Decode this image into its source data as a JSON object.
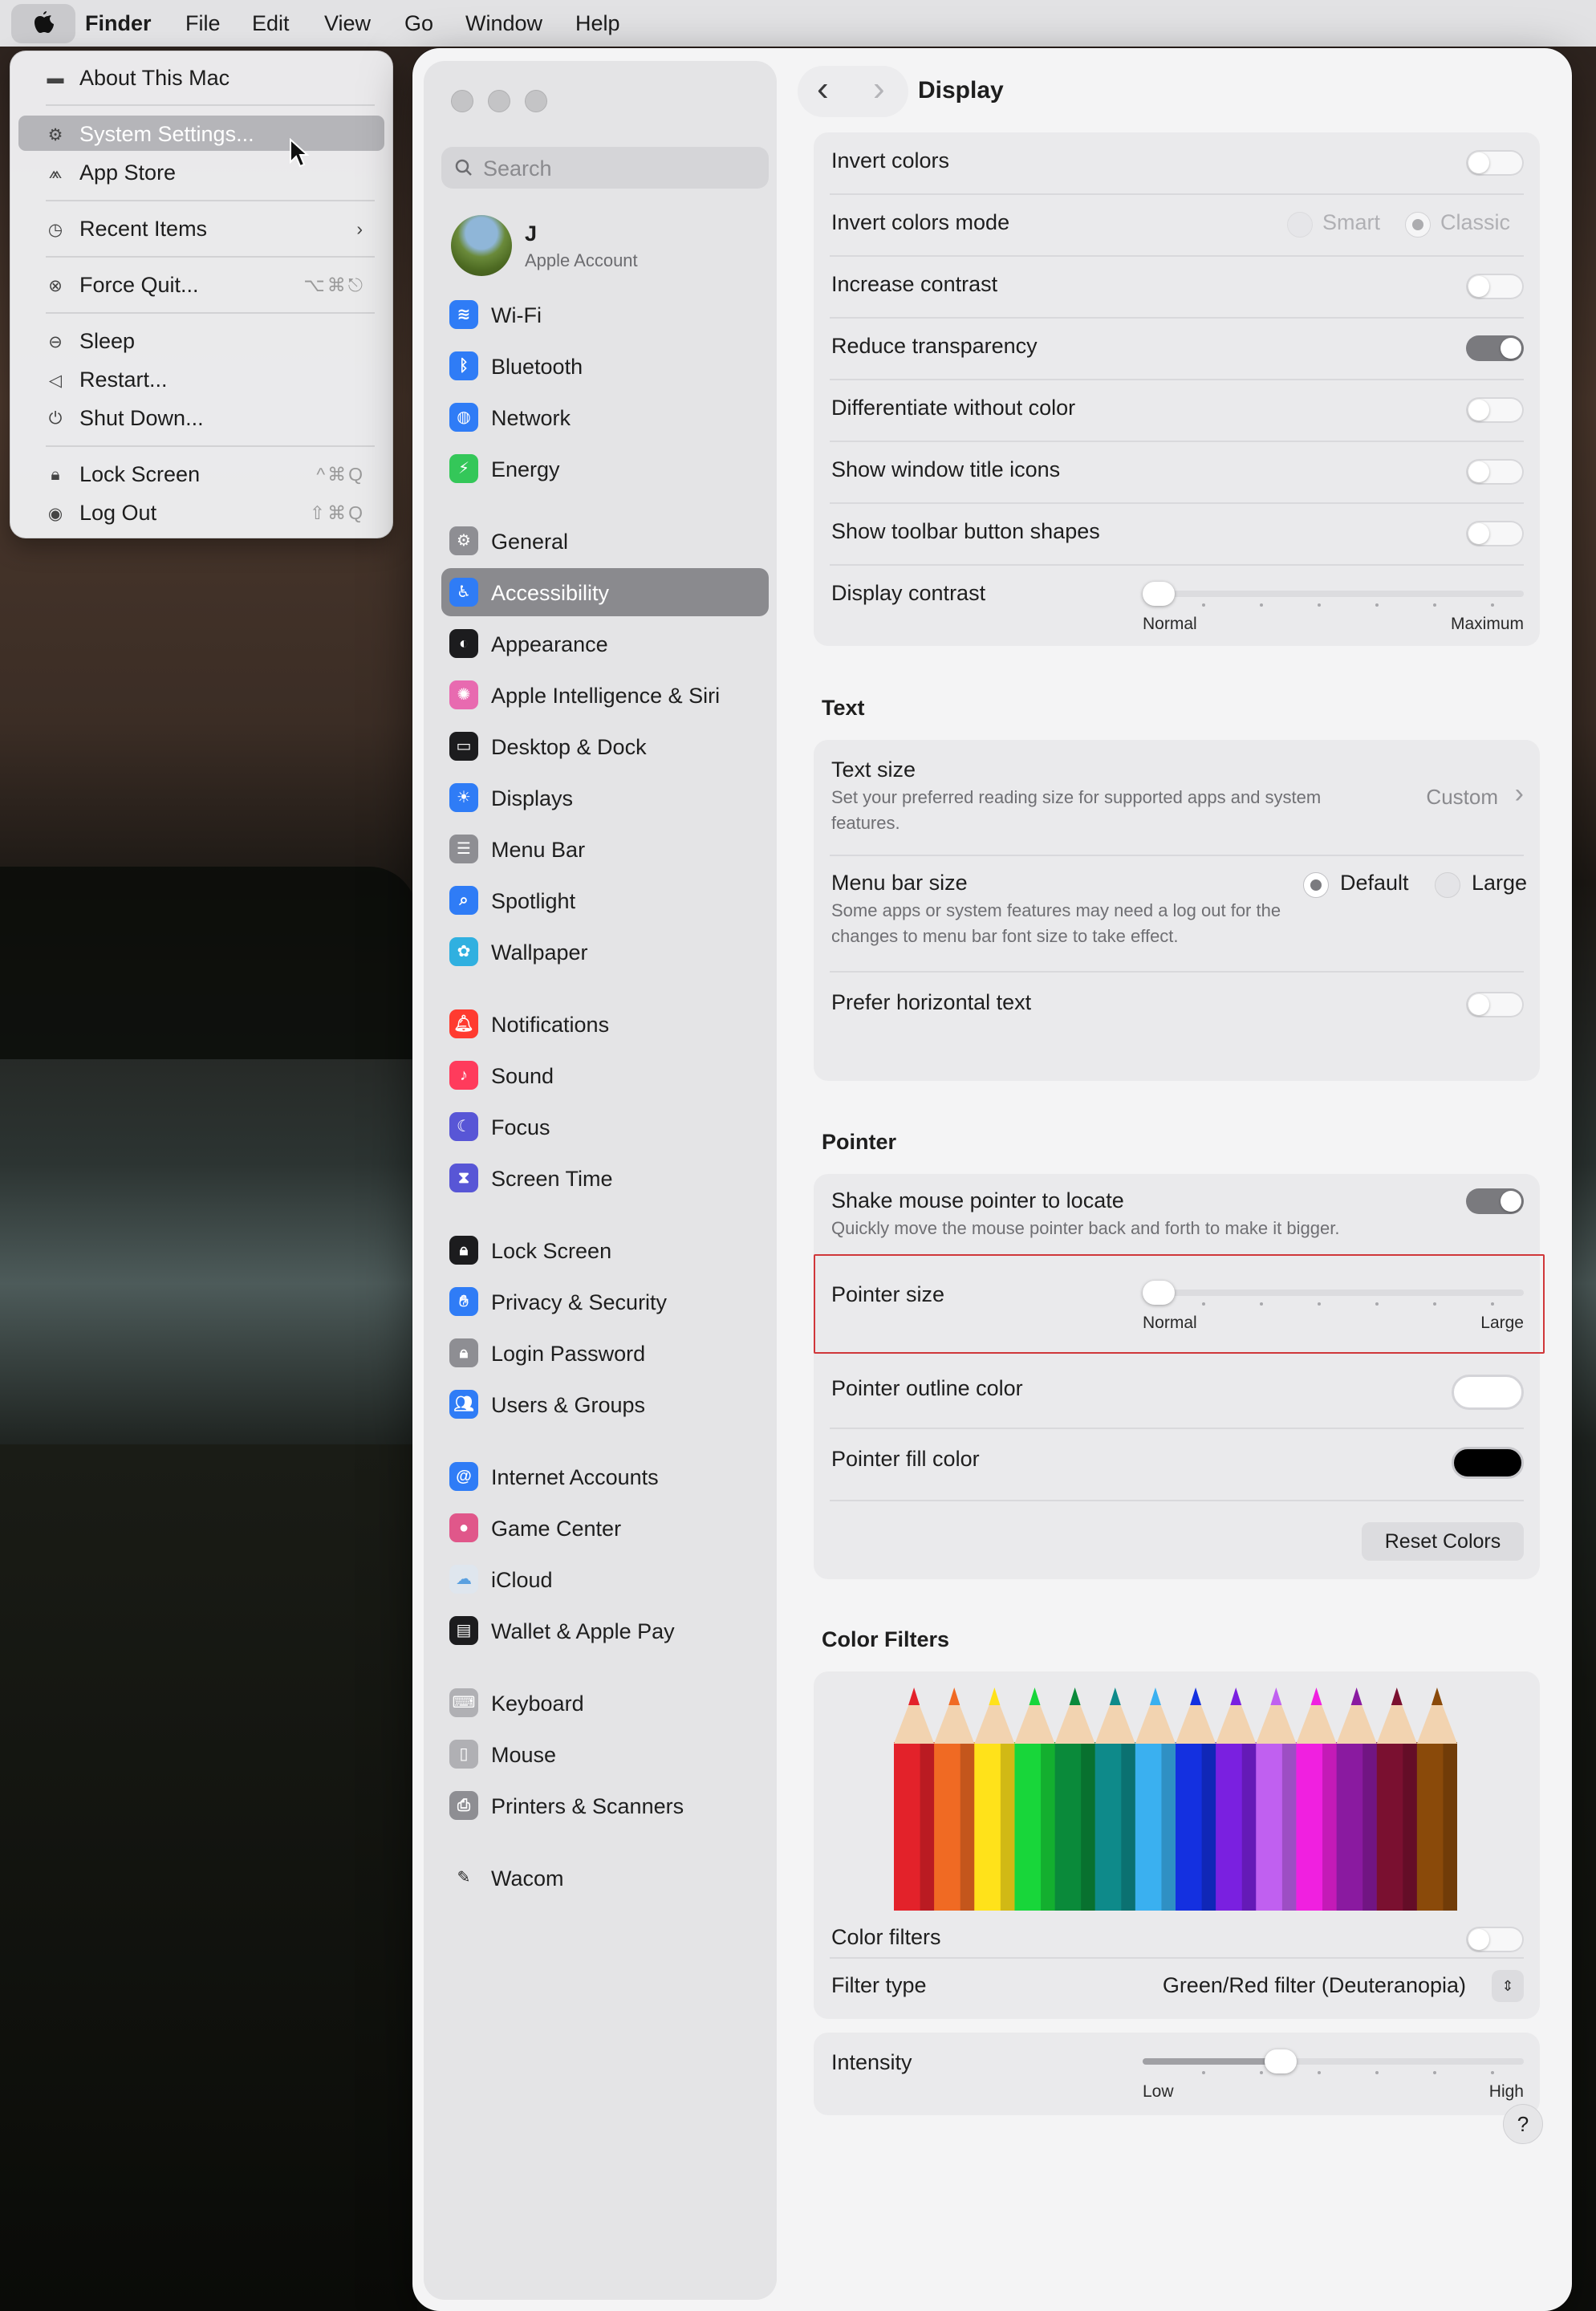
{
  "menubar": {
    "app_name": "Finder",
    "menus": [
      "File",
      "Edit",
      "View",
      "Go",
      "Window",
      "Help"
    ]
  },
  "apple_menu": {
    "items": [
      {
        "label": "About This Mac",
        "icon": "laptop-icon",
        "shortcut": ""
      },
      {
        "label": "System Settings...",
        "icon": "gear-icon",
        "shortcut": ""
      },
      {
        "label": "App Store",
        "icon": "app-store-icon",
        "shortcut": ""
      },
      {
        "label": "Recent Items",
        "icon": "clock-icon",
        "shortcut": ""
      },
      {
        "label": "Force Quit...",
        "icon": "force-quit-icon",
        "shortcut": "⌥⌘⎋"
      },
      {
        "label": "Sleep",
        "icon": "moon-icon",
        "shortcut": ""
      },
      {
        "label": "Restart...",
        "icon": "restart-icon",
        "shortcut": ""
      },
      {
        "label": "Shut Down...",
        "icon": "power-icon",
        "shortcut": ""
      },
      {
        "label": "Lock Screen",
        "icon": "lock-icon",
        "shortcut": "^⌘Q"
      },
      {
        "label": "Log Out",
        "icon": "user-icon",
        "shortcut": "⇧⌘Q"
      }
    ]
  },
  "sidebar": {
    "search_placeholder": "Search",
    "account": {
      "name": "J",
      "subtitle": "Apple Account"
    },
    "items": [
      {
        "label": "Wi-Fi",
        "icon": "wifi-icon",
        "color": "#2f7cf6"
      },
      {
        "label": "Bluetooth",
        "icon": "bluetooth-icon",
        "color": "#2f7cf6"
      },
      {
        "label": "Network",
        "icon": "globe-icon",
        "color": "#2f7cf6"
      },
      {
        "label": "Energy",
        "icon": "battery-icon",
        "color": "#34c759"
      },
      {
        "label": "General",
        "icon": "gear-icon",
        "color": "#8e8e93"
      },
      {
        "label": "Accessibility",
        "icon": "accessibility-icon",
        "color": "#2f7cf6"
      },
      {
        "label": "Appearance",
        "icon": "appearance-icon",
        "color": "#1c1c1e"
      },
      {
        "label": "Apple Intelligence & Siri",
        "icon": "siri-icon",
        "color": "#e86ab0"
      },
      {
        "label": "Desktop & Dock",
        "icon": "dock-icon",
        "color": "#1c1c1e"
      },
      {
        "label": "Displays",
        "icon": "sun-icon",
        "color": "#2f7cf6"
      },
      {
        "label": "Menu Bar",
        "icon": "menubar-icon",
        "color": "#8e8e93"
      },
      {
        "label": "Spotlight",
        "icon": "magnifier-icon",
        "color": "#2f7cf6"
      },
      {
        "label": "Wallpaper",
        "icon": "flower-icon",
        "color": "#30b0e0"
      },
      {
        "label": "Notifications",
        "icon": "bell-icon",
        "color": "#ff3b30"
      },
      {
        "label": "Sound",
        "icon": "speaker-icon",
        "color": "#ff3b5c"
      },
      {
        "label": "Focus",
        "icon": "moon-icon",
        "color": "#5856d6"
      },
      {
        "label": "Screen Time",
        "icon": "hourglass-icon",
        "color": "#5856d6"
      },
      {
        "label": "Lock Screen",
        "icon": "lock-icon",
        "color": "#1c1c1e"
      },
      {
        "label": "Privacy & Security",
        "icon": "hand-icon",
        "color": "#2f7cf6"
      },
      {
        "label": "Login Password",
        "icon": "lock-icon",
        "color": "#8e8e93"
      },
      {
        "label": "Users & Groups",
        "icon": "users-icon",
        "color": "#2f7cf6"
      },
      {
        "label": "Internet Accounts",
        "icon": "at-icon",
        "color": "#2f7cf6"
      },
      {
        "label": "Game Center",
        "icon": "game-center-icon",
        "color": "#e0578a"
      },
      {
        "label": "iCloud",
        "icon": "cloud-icon",
        "color": "#dfe6ee"
      },
      {
        "label": "Wallet & Apple Pay",
        "icon": "wallet-icon",
        "color": "#1c1c1e"
      },
      {
        "label": "Keyboard",
        "icon": "keyboard-icon",
        "color": "#b0b0b4"
      },
      {
        "label": "Mouse",
        "icon": "mouse-icon",
        "color": "#b0b0b4"
      },
      {
        "label": "Printers & Scanners",
        "icon": "printer-icon",
        "color": "#8e8e93"
      },
      {
        "label": "Wacom",
        "icon": "wacom-icon",
        "color": "#2a2a2a"
      }
    ]
  },
  "content": {
    "title": "Display",
    "display_rows": [
      {
        "label": "Invert colors",
        "on": false
      },
      {
        "label": "Invert colors mode"
      },
      {
        "label": "Increase contrast",
        "on": false
      },
      {
        "label": "Reduce transparency",
        "on": true
      },
      {
        "label": "Differentiate without color",
        "on": false
      },
      {
        "label": "Show window title icons",
        "on": false
      },
      {
        "label": "Show toolbar button shapes",
        "on": false
      },
      {
        "label": "Display contrast"
      }
    ],
    "invert_mode": {
      "options": [
        "Smart",
        "Classic"
      ],
      "selected": "Classic"
    },
    "display_contrast": {
      "min_label": "Normal",
      "max_label": "Maximum",
      "value": 0
    },
    "text": {
      "section": "Text",
      "text_size": {
        "label": "Text size",
        "description": "Set your preferred reading size for supported apps and system features.",
        "value": "Custom"
      },
      "menu_bar_size": {
        "label": "Menu bar size",
        "description": "Some apps or system features may need a log out for the changes to menu bar font size to take effect.",
        "options": [
          "Default",
          "Large"
        ],
        "selected": "Default"
      },
      "prefer_horizontal": {
        "label": "Prefer horizontal text",
        "on": false
      }
    },
    "pointer": {
      "section": "Pointer",
      "shake": {
        "label": "Shake mouse pointer to locate",
        "description": "Quickly move the mouse pointer back and forth to make it bigger.",
        "on": true
      },
      "size": {
        "label": "Pointer size",
        "min_label": "Normal",
        "max_label": "Large",
        "value": 0
      },
      "outline": {
        "label": "Pointer outline color",
        "color": "#ffffff"
      },
      "fill": {
        "label": "Pointer fill color",
        "color": "#000000"
      },
      "reset_label": "Reset Colors"
    },
    "color_filters": {
      "section": "Color Filters",
      "pencil_colors": [
        "#e3222a",
        "#f06a23",
        "#ffe21a",
        "#18d63a",
        "#0a8a3a",
        "#0e8a8a",
        "#3ab0f0",
        "#1430e0",
        "#7a20e0",
        "#c060f0",
        "#f020e0",
        "#8a1aa0",
        "#7a1030",
        "#8a4a0a"
      ],
      "enable": {
        "label": "Color filters",
        "on": false
      },
      "filter_type": {
        "label": "Filter type",
        "value": "Green/Red filter (Deuteranopia)"
      },
      "intensity": {
        "label": "Intensity",
        "min_label": "Low",
        "max_label": "High",
        "value": 0.35
      }
    },
    "help_label": "?"
  }
}
